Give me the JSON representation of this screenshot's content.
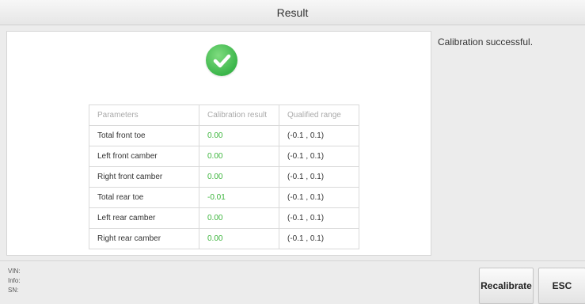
{
  "window": {
    "title": "Result"
  },
  "message": "Calibration successful.",
  "table": {
    "headers": [
      "Parameters",
      "Calibration result",
      "Qualified range"
    ],
    "rows": [
      {
        "parameter": "Total front toe",
        "result": "0.00",
        "range": "(-0.1 , 0.1)"
      },
      {
        "parameter": "Left front camber",
        "result": "0.00",
        "range": "(-0.1 , 0.1)"
      },
      {
        "parameter": "Right front camber",
        "result": "0.00",
        "range": "(-0.1 , 0.1)"
      },
      {
        "parameter": "Total rear toe",
        "result": "-0.01",
        "range": "(-0.1 , 0.1)"
      },
      {
        "parameter": "Left rear camber",
        "result": "0.00",
        "range": "(-0.1 , 0.1)"
      },
      {
        "parameter": "Right rear camber",
        "result": "0.00",
        "range": "(-0.1 , 0.1)"
      }
    ]
  },
  "footer": {
    "vin_label": "VIN:",
    "info_label": "Info:",
    "sn_label": "SN:",
    "recalibrate_label": "Recalibrate",
    "esc_label": "ESC"
  },
  "icons": {
    "status": "check-circle-icon"
  },
  "colors": {
    "success": "#3bb54a",
    "result_value": "#3cb53c"
  }
}
